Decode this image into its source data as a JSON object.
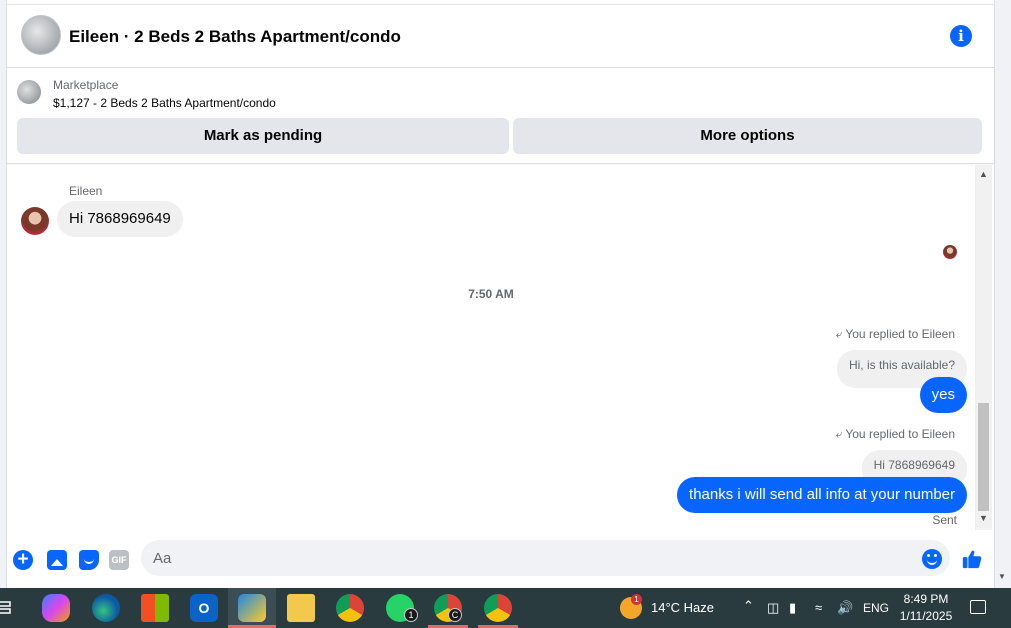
{
  "header": {
    "title": "Eileen · 2 Beds 2 Baths Apartment/condo",
    "info_icon": "info-icon"
  },
  "listing": {
    "kind": "Marketplace",
    "name": "$1,127 - 2 Beds 2 Baths Apartment/condo",
    "mark_pending_label": "Mark as pending",
    "more_options_label": "More options"
  },
  "thread": {
    "sender_name": "Eileen",
    "incoming_text": "Hi 7868969649",
    "timestamp": "7:50 AM",
    "replies": [
      {
        "note": "You replied to Eileen",
        "quoted": "Hi, is this available?",
        "text": "yes"
      },
      {
        "note": "You replied to Eileen",
        "quoted": "Hi 7868969649",
        "text": "thanks i will send all info at your number"
      }
    ],
    "status": "Sent"
  },
  "composer": {
    "placeholder": "Aa",
    "accent_color": "#0866ff"
  },
  "taskbar": {
    "weather_badge": "1",
    "weather": "14°C  Haze",
    "language": "ENG",
    "time": "8:49 PM",
    "date": "1/11/2025",
    "whatsapp_badge": "1",
    "chrome_profile_badge": "C",
    "apps": [
      "task-view-icon",
      "copilot-icon",
      "edge-icon",
      "store-icon",
      "outlook-icon",
      "pinned-app-icon",
      "file-explorer-icon",
      "chrome-icon",
      "whatsapp-icon",
      "chrome-profile-icon",
      "chrome-profile-2-icon"
    ]
  }
}
